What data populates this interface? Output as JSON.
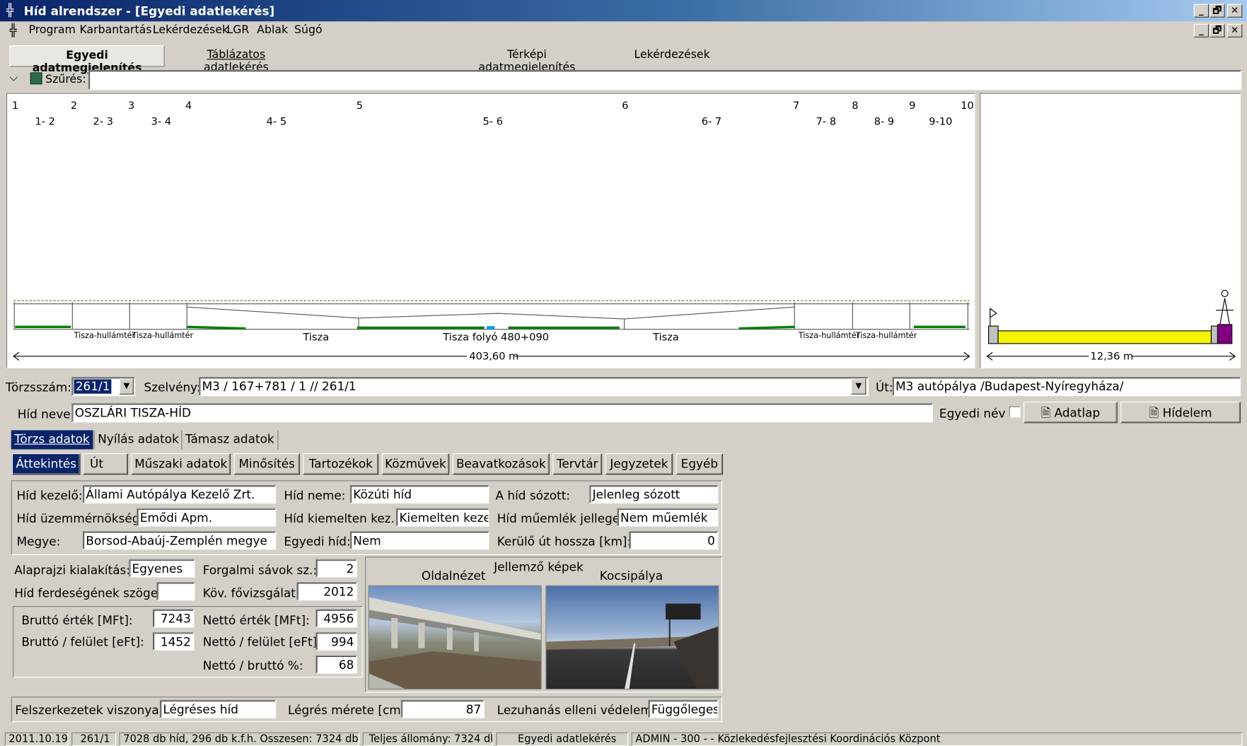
{
  "window": {
    "title": "Híd alrendszer - [Egyedi adatlekérés]",
    "min_glyph": "_",
    "restore_glyph": "🗗",
    "close_glyph": "✕"
  },
  "menu": [
    "Program",
    "Karbantartás",
    "Lekérdezések",
    "LGR",
    "Ablak",
    "Súgó"
  ],
  "top_tabs": [
    "Egyedi adatmegjelenítés",
    "Táblázatos adatlekérés",
    "Térképi adatmegjelenítés",
    "Lekérdezések"
  ],
  "filter": {
    "label": "Szűrés:",
    "value": ""
  },
  "drawing": {
    "pillars": [
      "1",
      "2",
      "3",
      "4",
      "5",
      "6",
      "7",
      "8",
      "9",
      "10"
    ],
    "spans": [
      "1- 2",
      "2- 3",
      "3- 4",
      "4- 5",
      "5- 6",
      "6- 7",
      "7- 8",
      "8- 9",
      "9-10"
    ],
    "ground_labels": [
      "Tisza-hullámtér",
      "Tisza-hullámtér",
      "Tisza",
      "Tisza folyó 480+090",
      "Tisza",
      "Tisza-hullámtér",
      "Tisza-hullámtér"
    ],
    "length": "403,60 m",
    "width": "12,36 m"
  },
  "record": {
    "torzsszam_label": "Törzsszám:",
    "torzsszam": "261/1",
    "szelveny_label": "Szelvény:",
    "szelveny": "M3 / 167+781 / 1 // 261/1",
    "ut_label": "Út:",
    "ut": "M3 autópálya /Budapest-Nyíregyháza/",
    "hidnev_label": "Híd neve:",
    "hidnev": "OSZLÁRI TISZA-HÍD",
    "egyedi_nev_label": "Egyedi név",
    "adatlap_button": "Adatlap",
    "hidelem_button": "Hídelem"
  },
  "data_tabs": [
    "Törzs adatok",
    "Nyílás adatok",
    "Támasz adatok"
  ],
  "sub_tabs": [
    "Áttekintés",
    "Út",
    "Műszaki adatok",
    "Minősítés",
    "Tartozékok",
    "Közművek",
    "Beavatkozások",
    "Tervtár",
    "Jegyzetek",
    "Egyéb"
  ],
  "overview": {
    "kezelo_label": "Híd kezelő:",
    "kezelo": "Állami Autópálya Kezelő Zrt.",
    "hidneme_label": "Híd neme:",
    "hidneme": "Közúti híd",
    "sozott_label": "A híd sózott:",
    "sozott": "Jelenleg sózott",
    "uzemmernokseg_label": "Híd üzemmérnökség:",
    "uzemmernokseg": "Emődi Apm.",
    "kiemelten_label": "Híd kiemelten kez.:",
    "kiemelten": "Kiemelten keze",
    "mujemlek_label": "Híd műemlék jellege:",
    "mujemlek": "Nem műemlék",
    "megye_label": "Megye:",
    "megye": "Borsod-Abaúj-Zemplén megye",
    "egyedihid_label": "Egyedi híd:",
    "egyedihid": "Nem",
    "kerulo_label": "Kerülő út hossza [km]:",
    "kerulo": "0",
    "alaprajz_label": "Alaprajzi kialakítás:",
    "alaprajz": "Egyenes",
    "savok_label": "Forgalmi sávok sz.:",
    "savok": "2",
    "ferdeseg_label": "Híd ferdeségének szöge:",
    "ferdeseg": "",
    "fovizsgalat_label": "Köv. fővizsgálat:",
    "fovizsgalat": "2012",
    "brutto_label": "Bruttó érték [MFt]:",
    "brutto": "7243",
    "netto_label": "Nettó érték [MFt]:",
    "netto": "4956",
    "brutto_fel_label": "Bruttó / felület [eFt]:",
    "brutto_fel": "1452",
    "netto_fel_label": "Nettó / felület [eFt]:",
    "netto_fel": "994",
    "netto_brutto_label": "Nettó / bruttó %:",
    "netto_brutto": "68",
    "felszerkezet_label": "Felszerkezetek viszonya:",
    "felszerkezet": "Légréses híd",
    "legres_label": "Légrés mérete [cm]:",
    "legres": "87",
    "lezuhanas_label": "Lezuhanás elleni védelem:",
    "lezuhanas": "Függőleges"
  },
  "photos": {
    "title": "Jellemző képek",
    "left_caption": "Oldalnézet",
    "right_caption": "Kocsipálya"
  },
  "status": [
    "2011.10.19.",
    "261/1",
    "7028 db híd, 296 db k.f.h.  Összesen: 7324 db",
    "Teljes állomány: 7324 db",
    "Egyedi adatlekérés",
    "ADMIN - 300 - - Közlekedésfejlesztési Koordinációs Központ"
  ],
  "colors": {
    "title_active": "#0a246a",
    "road_yellow": "#f4f400",
    "marker_purple": "#800080",
    "ground_green": "#008000"
  }
}
